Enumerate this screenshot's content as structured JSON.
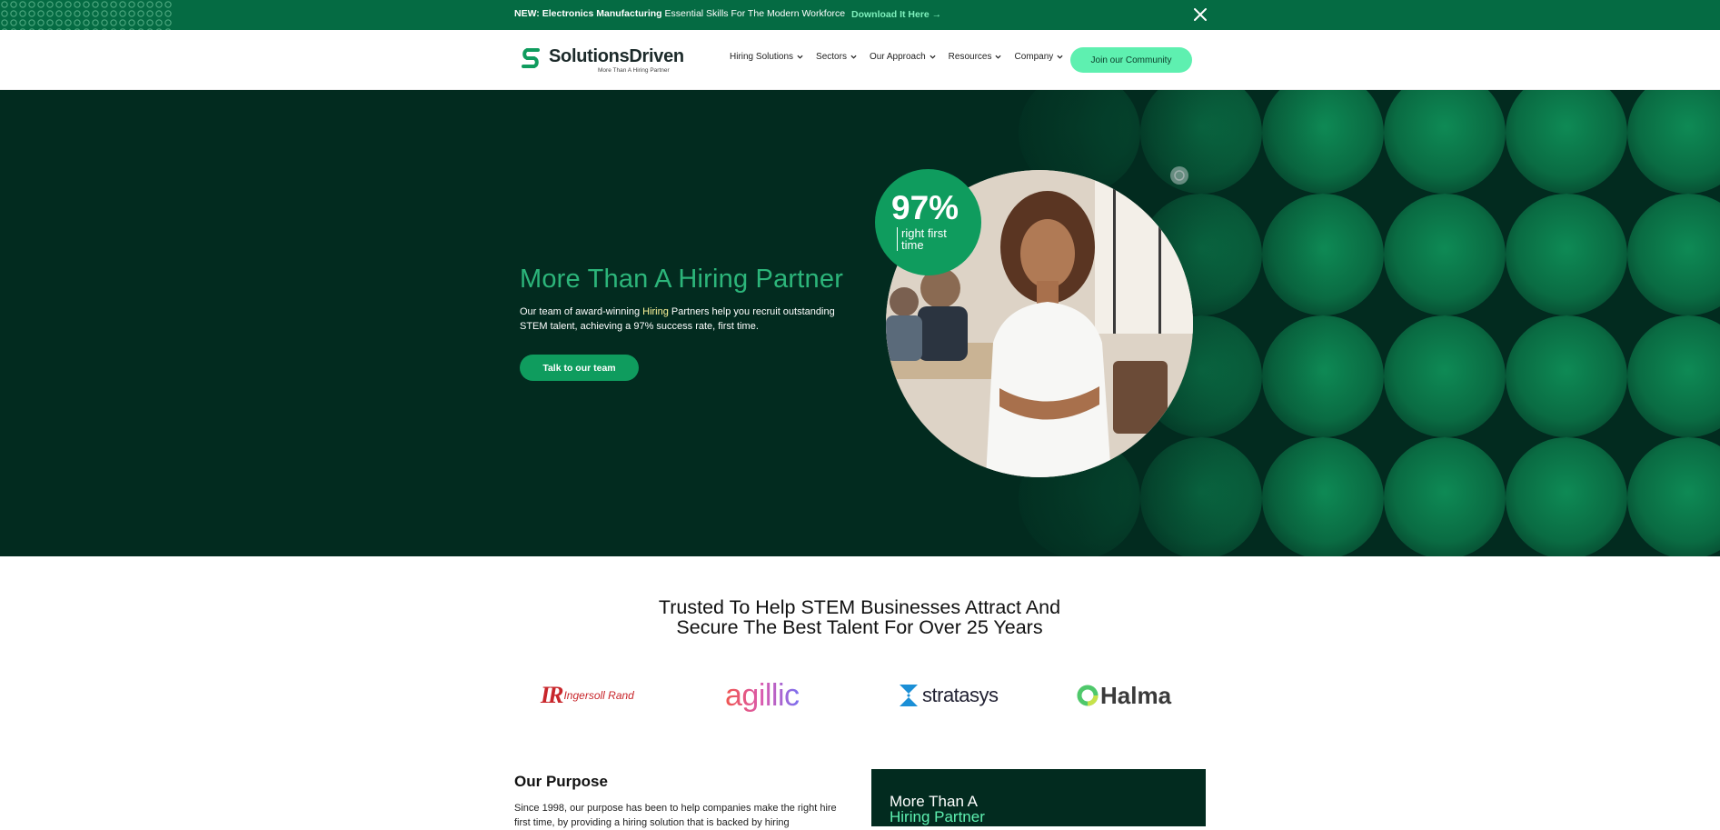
{
  "announcement": {
    "prefix": "NEW:",
    "highlight": "Electronics Manufacturing",
    "rest": "Essential Skills For The Modern Workforce",
    "link": "Download It Here →",
    "close_icon": "close-icon"
  },
  "nav": {
    "logo_word": "SolutionsDriven",
    "logo_tagline": "More Than A Hiring Partner",
    "items": [
      {
        "label": "Hiring Solutions"
      },
      {
        "label": "Sectors"
      },
      {
        "label": "Our Approach"
      },
      {
        "label": "Resources"
      },
      {
        "label": "Company"
      }
    ],
    "cta": "Join our Community"
  },
  "hero": {
    "title": "More Than A Hiring Partner",
    "text_before": "Our team of award-winning ",
    "text_highlight": "Hiring",
    "text_after": " Partners help you recruit outstanding STEM talent, achieving a 97% success rate, first time.",
    "button": "Talk to our team",
    "stat_value": "97%",
    "stat_label": "right first time"
  },
  "trusted": {
    "line1": "Trusted To Help STEM Businesses Attract And",
    "line2": "Secure The Best Talent For Over 25 Years"
  },
  "logos": [
    {
      "name": "Ingersoll Rand",
      "mark": "IR"
    },
    {
      "name": "agillic"
    },
    {
      "name": "stratasys"
    },
    {
      "name": "Halma"
    }
  ],
  "purpose": {
    "heading": "Our Purpose",
    "text": "Since 1998, our purpose has been to help companies make the right hire first time, by providing a hiring solution that is backed by hiring"
  },
  "card": {
    "line1": "More Than A",
    "line2": "Hiring Partner"
  },
  "colors": {
    "announce_bg": "#056b43",
    "hero_bg": "#022b1f",
    "accent": "#0f9c5e",
    "mint": "#5ef0b0",
    "title_green": "#2cb57a"
  }
}
